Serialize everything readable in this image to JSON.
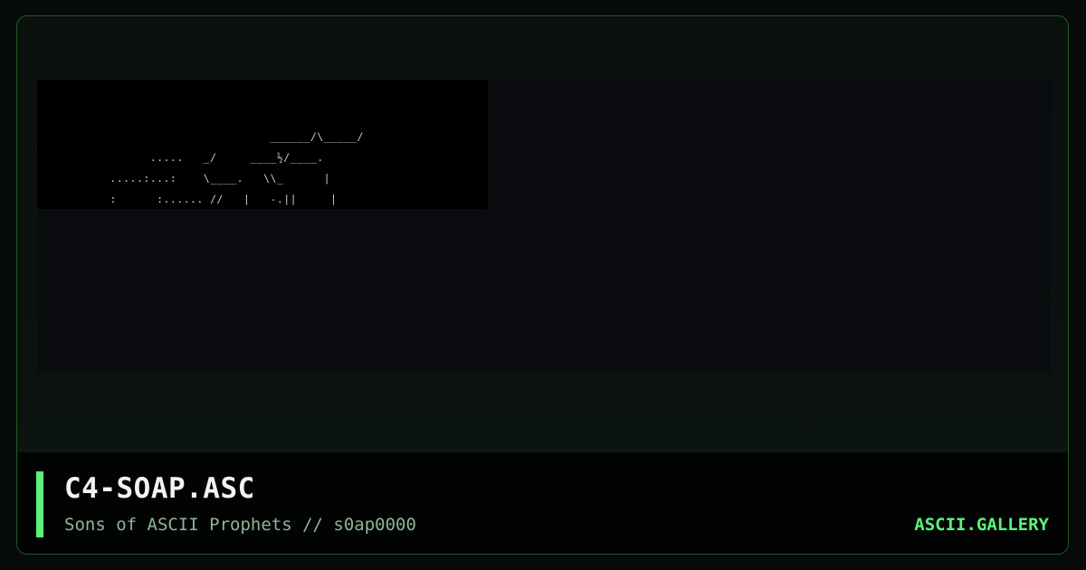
{
  "artwork": {
    "ascii_lines": [
      "                                 ______/\\_____/",
      "               .....   _/     ____½/____.",
      "         .....:...:    \\____.   \\\\_      |",
      "         :      :...... //   |   -.||     |"
    ]
  },
  "footer": {
    "title": "C4-SOAP.ASC",
    "subtitle": "Sons of ASCII Prophets // s0ap0000",
    "brand": "ASCII.GALLERY"
  },
  "colors": {
    "accent": "#5cf27a",
    "background": "#060a08",
    "border": "#1f5a2a",
    "art_text": "#c9c9c9",
    "subtitle_text": "#8fb596"
  }
}
